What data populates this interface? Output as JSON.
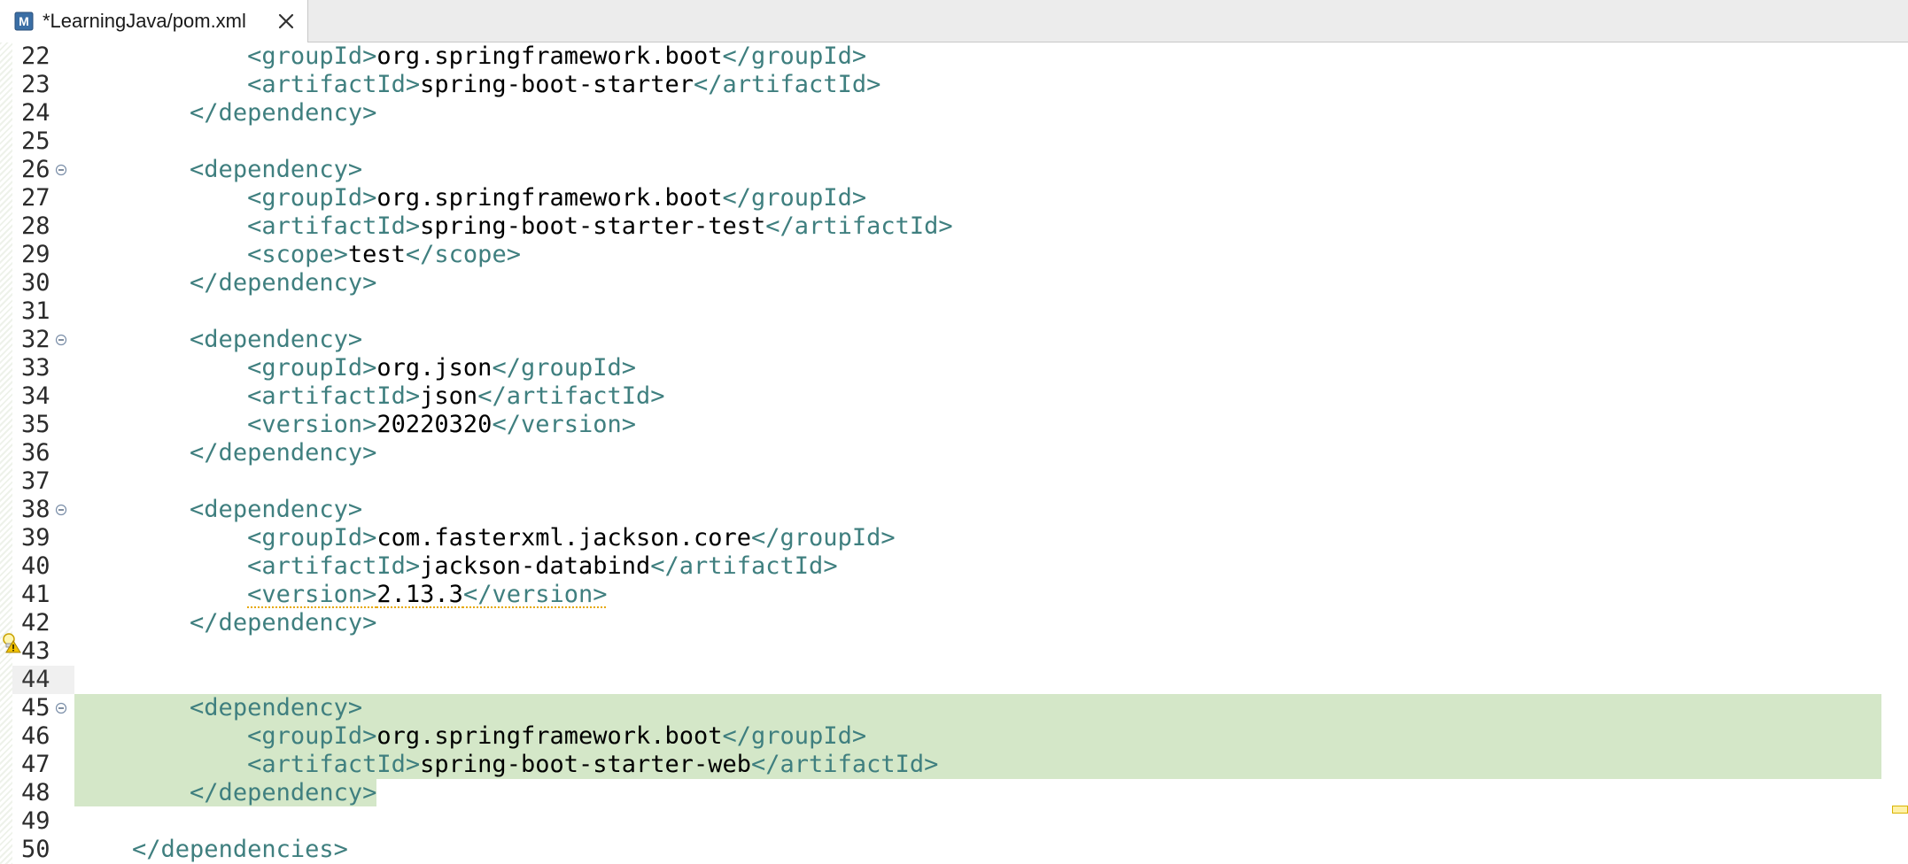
{
  "tab": {
    "title": "*LearningJava/pom.xml",
    "icon": "maven-pom-file-icon",
    "close_icon": "close-icon"
  },
  "editor": {
    "current_line": 44,
    "colors": {
      "tag": "#3f7f7f",
      "text": "#000000",
      "highlight": "#d4e7c8",
      "warning": "#e6a800"
    },
    "lines": [
      {
        "num": "22",
        "indent": "            ",
        "tag1": "<groupId>",
        "text": "org.springframework.boot",
        "tag2": "</groupId>"
      },
      {
        "num": "23",
        "indent": "            ",
        "tag1": "<artifactId>",
        "text": "spring-boot-starter",
        "tag2": "</artifactId>"
      },
      {
        "num": "24",
        "indent": "        ",
        "tag1": "</dependency>",
        "text": "",
        "tag2": ""
      },
      {
        "num": "25",
        "indent": "",
        "tag1": "",
        "text": "",
        "tag2": ""
      },
      {
        "num": "26",
        "indent": "        ",
        "tag1": "<dependency>",
        "text": "",
        "tag2": ""
      },
      {
        "num": "27",
        "indent": "            ",
        "tag1": "<groupId>",
        "text": "org.springframework.boot",
        "tag2": "</groupId>"
      },
      {
        "num": "28",
        "indent": "            ",
        "tag1": "<artifactId>",
        "text": "spring-boot-starter-test",
        "tag2": "</artifactId>"
      },
      {
        "num": "29",
        "indent": "            ",
        "tag1": "<scope>",
        "text": "test",
        "tag2": "</scope>"
      },
      {
        "num": "30",
        "indent": "        ",
        "tag1": "</dependency>",
        "text": "",
        "tag2": ""
      },
      {
        "num": "31",
        "indent": "",
        "tag1": "",
        "text": "",
        "tag2": ""
      },
      {
        "num": "32",
        "indent": "        ",
        "tag1": "<dependency>",
        "text": "",
        "tag2": ""
      },
      {
        "num": "33",
        "indent": "            ",
        "tag1": "<groupId>",
        "text": "org.json",
        "tag2": "</groupId>"
      },
      {
        "num": "34",
        "indent": "            ",
        "tag1": "<artifactId>",
        "text": "json",
        "tag2": "</artifactId>"
      },
      {
        "num": "35",
        "indent": "            ",
        "tag1": "<version>",
        "text": "20220320",
        "tag2": "</version>"
      },
      {
        "num": "36",
        "indent": "        ",
        "tag1": "</dependency>",
        "text": "",
        "tag2": ""
      },
      {
        "num": "37",
        "indent": "",
        "tag1": "",
        "text": "",
        "tag2": ""
      },
      {
        "num": "38",
        "indent": "        ",
        "tag1": "<dependency>",
        "text": "",
        "tag2": ""
      },
      {
        "num": "39",
        "indent": "            ",
        "tag1": "<groupId>",
        "text": "com.fasterxml.jackson.core",
        "tag2": "</groupId>"
      },
      {
        "num": "40",
        "indent": "            ",
        "tag1": "<artifactId>",
        "text": "jackson-databind",
        "tag2": "</artifactId>"
      },
      {
        "num": "41",
        "indent": "            ",
        "tag1": "<version>",
        "text": "2.13.3",
        "tag2": "</version>"
      },
      {
        "num": "42",
        "indent": "        ",
        "tag1": "</dependency>",
        "text": "",
        "tag2": ""
      },
      {
        "num": "43",
        "indent": "",
        "tag1": "",
        "text": "",
        "tag2": ""
      },
      {
        "num": "44",
        "indent": "",
        "tag1": "",
        "text": "",
        "tag2": ""
      },
      {
        "num": "45",
        "indent": "        ",
        "tag1": "<dependency>",
        "text": "",
        "tag2": ""
      },
      {
        "num": "46",
        "indent": "            ",
        "tag1": "<groupId>",
        "text": "org.springframework.boot",
        "tag2": "</groupId>"
      },
      {
        "num": "47",
        "indent": "            ",
        "tag1": "<artifactId>",
        "text": "spring-boot-starter-web",
        "tag2": "</artifactId>"
      },
      {
        "num": "48",
        "indent": "        ",
        "tag1": "</dependency>",
        "text": "",
        "tag2": ""
      },
      {
        "num": "49",
        "indent": "",
        "tag1": "",
        "text": "",
        "tag2": ""
      },
      {
        "num": "50",
        "indent": "    ",
        "tag1": "</dependencies>",
        "text": "",
        "tag2": ""
      }
    ]
  }
}
